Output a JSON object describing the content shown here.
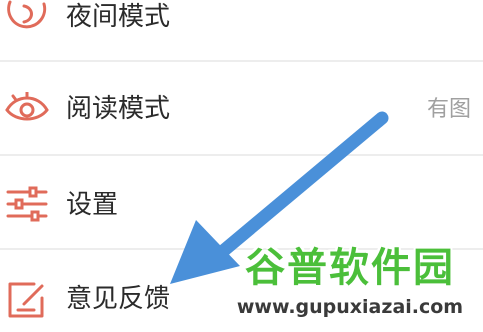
{
  "menu": {
    "items": [
      {
        "label": "夜间模式",
        "icon": "moon-icon",
        "value": ""
      },
      {
        "label": "阅读模式",
        "icon": "eye-icon",
        "value": "有图"
      },
      {
        "label": "设置",
        "icon": "sliders-icon",
        "value": ""
      },
      {
        "label": "意见反馈",
        "icon": "feedback-edit-icon",
        "value": ""
      }
    ]
  },
  "annotation": {
    "arrow_color": "#4a90d9"
  },
  "watermark": {
    "title": "谷普软件园",
    "url": "www.gupuxiazai.com"
  },
  "colors": {
    "icon_accent": "#e06b5a",
    "label_text": "#2b2b2b",
    "secondary_text": "#a0a0a0",
    "divider": "#ededed"
  }
}
